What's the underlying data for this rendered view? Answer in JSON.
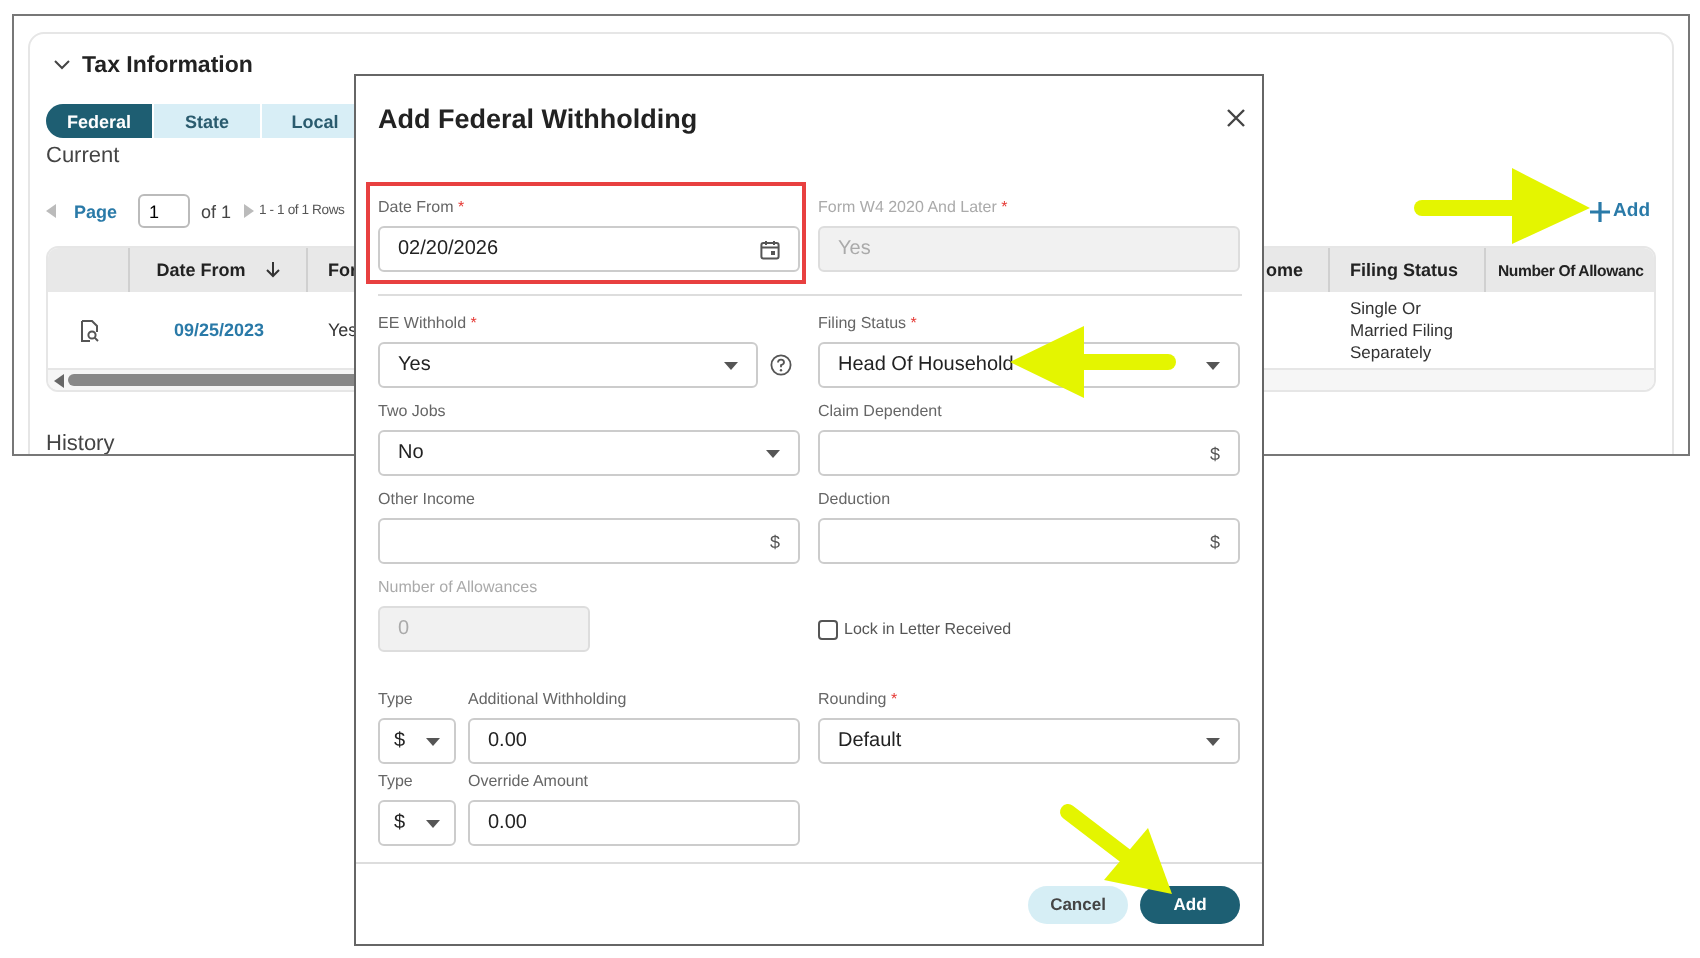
{
  "background": {
    "section_title": "Tax Information",
    "expanded": true,
    "tabs": [
      {
        "label": "Federal",
        "selected": true
      },
      {
        "label": "State",
        "selected": false
      },
      {
        "label": "Local",
        "selected": false
      }
    ],
    "current_heading": "Current",
    "pagination": {
      "page_label": "Page",
      "page": "1",
      "of_pages": "of 1",
      "rows_info": "1 - 1 of 1 Rows"
    },
    "add_link": {
      "label": "Add",
      "arrow": true
    },
    "table": {
      "columns": [
        {
          "label": "Date From",
          "sorted": true
        },
        {
          "label": "For",
          "sorted": false
        },
        {
          "label": "ome",
          "sorted": false
        },
        {
          "label": "Filing Status",
          "sorted": false
        },
        {
          "label": "Number Of Allowanc",
          "sorted": false
        }
      ],
      "rows": [
        {
          "cells": [
            "09/25/2023",
            "Yes",
            null,
            "Single Or Married Filing Separately",
            null
          ]
        }
      ]
    },
    "history_heading": "History"
  },
  "dialog": {
    "title": "Add Federal Withholding",
    "required_mark": "*",
    "sections": [
      {
        "kind": "fields",
        "rows": [
          [
            {
              "kind": "date",
              "label": "Date From",
              "required": true,
              "value": "02/20/2026",
              "highlighted": true
            },
            {
              "kind": "text",
              "label": "Form W4 2020 And Later",
              "required": true,
              "value": "Yes",
              "disabled": true
            }
          ]
        ]
      },
      {
        "kind": "divider"
      },
      {
        "kind": "fields",
        "rows": [
          [
            {
              "kind": "select",
              "label": "EE Withhold",
              "required": true,
              "value": "Yes",
              "help": true
            },
            {
              "kind": "select",
              "label": "Filing Status",
              "required": true,
              "value": "Head Of Household",
              "arrow": true
            }
          ],
          [
            {
              "kind": "select",
              "label": "Two Jobs",
              "required": false,
              "value": "No"
            },
            {
              "kind": "currency",
              "label": "Claim Dependent",
              "required": false,
              "suffix": "$"
            }
          ],
          [
            {
              "kind": "currency",
              "label": "Other Income",
              "required": false,
              "suffix": "$"
            },
            {
              "kind": "currency",
              "label": "Deduction",
              "required": false,
              "suffix": "$"
            }
          ],
          [
            {
              "kind": "number",
              "label": "Number of Allowances",
              "required": false,
              "value": "0",
              "disabled": true
            },
            {
              "kind": "checkbox",
              "label": "Lock in Letter Received",
              "checked": false
            }
          ]
        ]
      },
      {
        "kind": "fields",
        "rows": [
          [
            {
              "kind": "typed_amount",
              "type_label": "Type",
              "type_value": "$",
              "label": "Additional Withholding",
              "value": "0.00"
            },
            {
              "kind": "select",
              "label": "Rounding",
              "required": true,
              "value": "Default"
            }
          ],
          [
            {
              "kind": "typed_amount",
              "type_label": "Type",
              "type_value": "$",
              "label": "Override Amount",
              "value": "0.00"
            }
          ]
        ]
      }
    ],
    "buttons": [
      {
        "label": "Cancel",
        "kind": "secondary"
      },
      {
        "label": "Add",
        "kind": "primary",
        "arrow": true
      }
    ]
  }
}
